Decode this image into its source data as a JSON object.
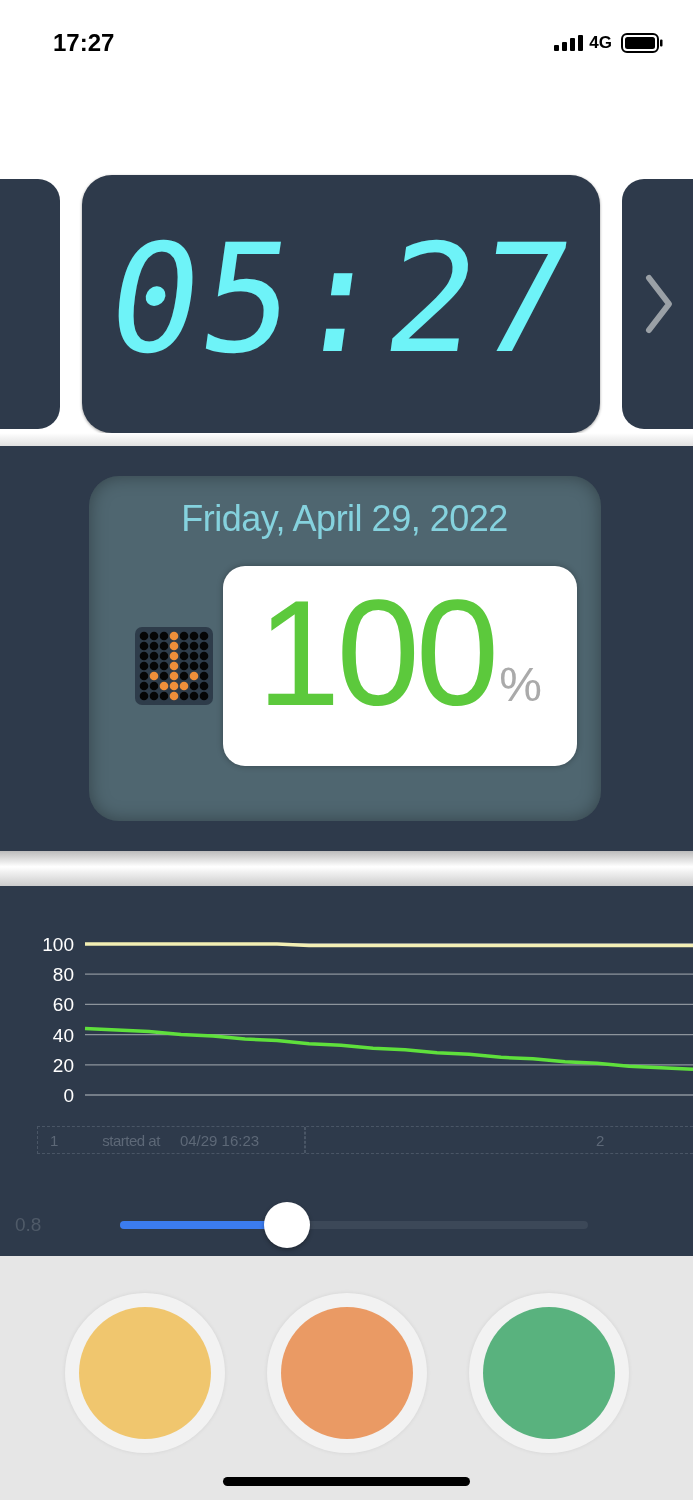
{
  "status_bar": {
    "time": "17:27",
    "network": "4G"
  },
  "timer": {
    "display": "05:27"
  },
  "date": "Friday, April 29, 2022",
  "battery": {
    "value": "100",
    "unit": "%"
  },
  "chart_data": {
    "type": "line",
    "grid": true,
    "ylim": [
      0,
      100
    ],
    "yticks": [
      0,
      20,
      40,
      60,
      80,
      100
    ],
    "series": [
      {
        "color": "#f3efb4",
        "values": [
          100,
          100,
          100,
          100,
          100,
          100,
          100,
          99,
          99,
          99,
          99,
          99,
          99,
          99,
          99,
          99,
          99,
          99,
          99,
          99
        ]
      },
      {
        "color": "#5fe03c",
        "values": [
          44,
          43,
          42,
          40,
          39,
          37,
          36,
          34,
          33,
          31,
          30,
          28,
          27,
          25,
          24,
          22,
          21,
          19,
          18,
          17
        ]
      }
    ]
  },
  "timeline": [
    {
      "index": "1",
      "label": "started at",
      "time": "04/29 16:23"
    },
    {
      "index": "2"
    }
  ],
  "slider": {
    "reading": "0.8",
    "level": 0.357
  },
  "buttons": [
    {
      "color": "#f0c66e"
    },
    {
      "color": "#ea9a64"
    },
    {
      "color": "#59b27e"
    }
  ]
}
